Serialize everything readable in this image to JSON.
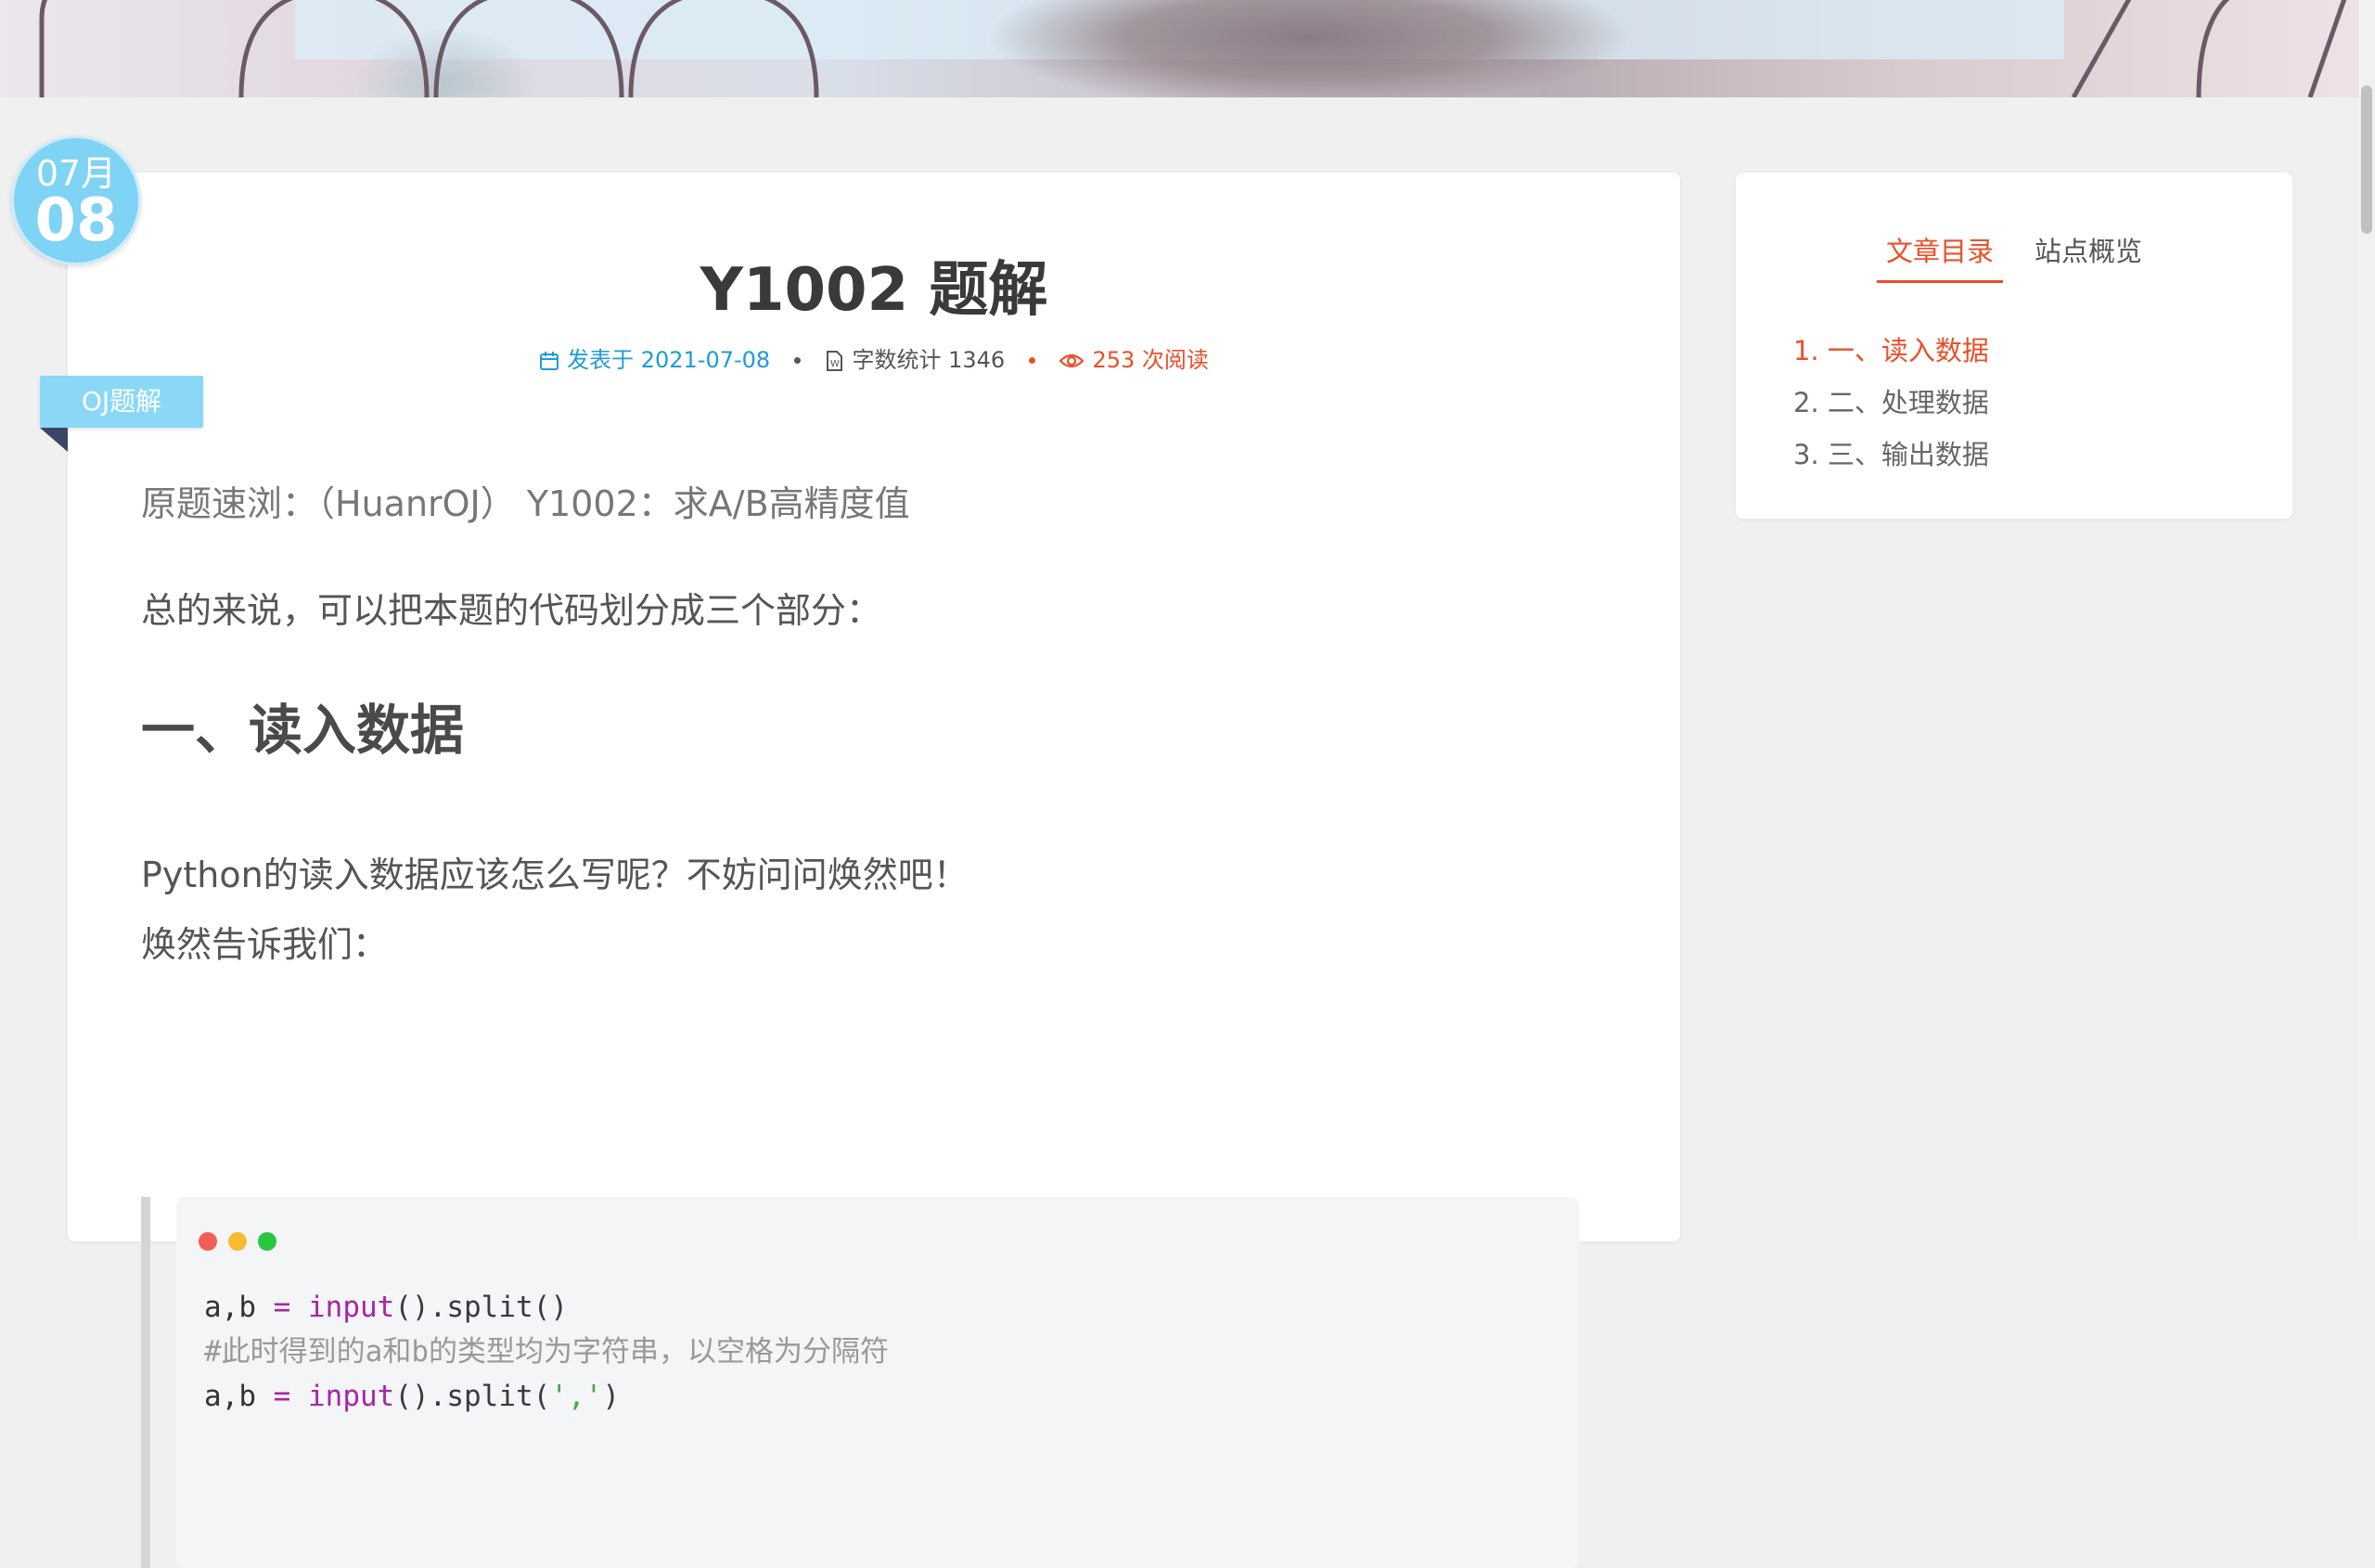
{
  "date_badge": {
    "month": "07月",
    "day": "08"
  },
  "category": "OJ题解",
  "post": {
    "title": "Y1002 题解",
    "meta": {
      "published": "发表于 2021-07-08",
      "words": "字数统计 1346",
      "views": "253 次阅读"
    },
    "paragraphs": {
      "intro": "原题速浏：（HuanrOJ） Y1002：求A/B高精度值",
      "summary": "总的来说，可以把本题的代码划分成三个部分：",
      "heading1": "一、读入数据",
      "question": "Python的读入数据应该怎么写呢？不妨问问焕然吧！",
      "answer": "焕然告诉我们："
    },
    "code": {
      "line1_a": "a,b",
      "line1_op": "=",
      "line1_fn": "input",
      "line1_rest": "().split()",
      "line2_comment": "#此时得到的a和b的类型均为字符串，以空格为分隔符",
      "line3_a": "a,b",
      "line3_op": "=",
      "line3_fn": "input",
      "line3_rest1": "().split(",
      "line3_str": "','",
      "line3_rest2": ")"
    }
  },
  "sidebar": {
    "tabs": [
      "文章目录",
      "站点概览"
    ],
    "toc": [
      "1. 一、读入数据",
      "2. 二、处理数据",
      "3. 三、输出数据"
    ]
  },
  "colors": {
    "accent": "#e8502a",
    "link": "#1f9bd7",
    "badge": "#7fd3f5",
    "dot_red": "#f25e57",
    "dot_yellow": "#f7bb2f",
    "dot_green": "#29c640"
  }
}
